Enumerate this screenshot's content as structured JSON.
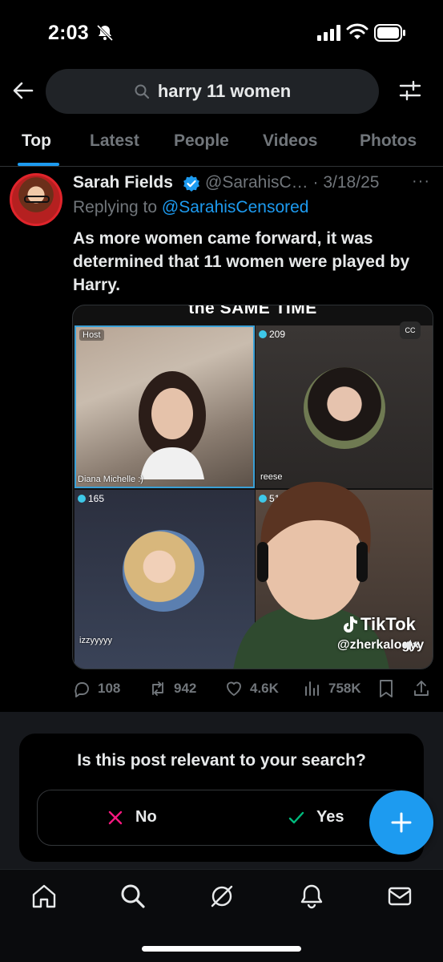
{
  "status_bar": {
    "time": "2:03",
    "icons": [
      "bell-slash-icon",
      "signal-icon",
      "wifi-icon",
      "battery-icon"
    ]
  },
  "search": {
    "query": "harry 11 women",
    "icons": [
      "back-arrow-icon",
      "search-icon",
      "filter-icon"
    ]
  },
  "tabs": [
    {
      "label": "Top",
      "active": true
    },
    {
      "label": "Latest",
      "active": false
    },
    {
      "label": "People",
      "active": false
    },
    {
      "label": "Videos",
      "active": false
    },
    {
      "label": "Photos",
      "active": false
    }
  ],
  "post": {
    "author_name": "Sarah Fields",
    "handle": "@SarahisC…",
    "date_sep": " · ",
    "date": "3/18/25",
    "more": "···",
    "reply_prefix": "Replying to",
    "reply_to": "@SarahisCensored",
    "text": "As more women came forward, it was determined that 11 women were played by Harry.",
    "media": {
      "caption": "the SAME TIME",
      "host_label": "Host",
      "host_name": "Diana Michelle :)",
      "reese_count": "209",
      "reese_name": "reese",
      "izzy_count": "165",
      "izzy_name": "izzyyyyy",
      "cam_count": "51",
      "cc_label": "CC",
      "tiktok_brand": "TikTok",
      "tiktok_handle": "@zherkalogyy"
    },
    "stats": {
      "replies": "108",
      "reposts": "942",
      "likes": "4.6K",
      "views": "758K"
    }
  },
  "relevance": {
    "question": "Is this post relevant to your search?",
    "no_label": "No",
    "yes_label": "Yes"
  },
  "colors": {
    "accent": "#1d9bf0",
    "no": "#f91880",
    "yes": "#00ba7c",
    "muted": "#71767b"
  },
  "bottom_nav": [
    "home-icon",
    "search-icon",
    "grok-icon",
    "notifications-icon",
    "messages-icon"
  ]
}
